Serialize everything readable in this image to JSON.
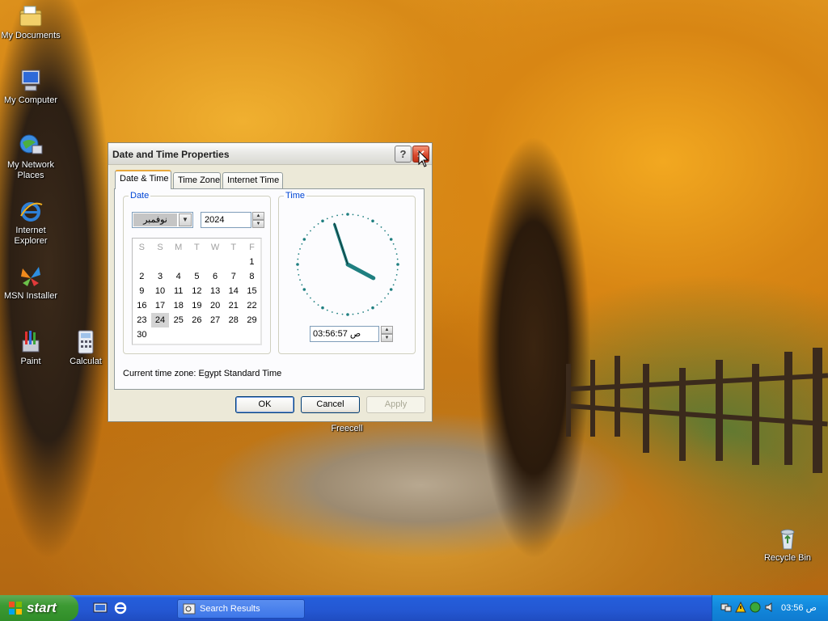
{
  "desktop": {
    "icons": [
      {
        "label": "My Documents",
        "icon": "folder-documents-icon"
      },
      {
        "label": "My Computer",
        "icon": "computer-icon"
      },
      {
        "label": "My Network Places",
        "icon": "network-places-icon"
      },
      {
        "label": "Internet Explorer",
        "icon": "internet-explorer-icon"
      },
      {
        "label": "MSN Installer",
        "icon": "msn-butterfly-icon"
      },
      {
        "label": "Paint",
        "icon": "paint-icon"
      },
      {
        "label": "Calculat",
        "icon": "calculator-icon"
      },
      {
        "label": "Freecell",
        "icon": "freecell-icon"
      },
      {
        "label": "Recycle Bin",
        "icon": "recycle-bin-icon"
      }
    ]
  },
  "dialog": {
    "title": "Date and Time Properties",
    "help_glyph": "?",
    "close_glyph": "✕",
    "tabs": [
      {
        "label": "Date & Time",
        "active": true
      },
      {
        "label": "Time Zone",
        "active": false
      },
      {
        "label": "Internet Time",
        "active": false
      }
    ],
    "date": {
      "group_title": "Date",
      "month": "نوفمبر",
      "year": "2024",
      "weekday_headers": [
        "S",
        "S",
        "M",
        "T",
        "W",
        "T",
        "F"
      ],
      "weeks": [
        [
          "",
          "",
          "",
          "",
          "",
          "",
          "1"
        ],
        [
          "2",
          "3",
          "4",
          "5",
          "6",
          "7",
          "8"
        ],
        [
          "9",
          "10",
          "11",
          "12",
          "13",
          "14",
          "15"
        ],
        [
          "16",
          "17",
          "18",
          "19",
          "20",
          "21",
          "22"
        ],
        [
          "23",
          "24",
          "25",
          "26",
          "27",
          "28",
          "29"
        ],
        [
          "30",
          "",
          "",
          "",
          "",
          "",
          ""
        ]
      ],
      "selected_day": "24"
    },
    "time": {
      "group_title": "Time",
      "value": "03:56:57 ص",
      "hour": 3,
      "minute": 56,
      "second": 57
    },
    "current_time_zone": "Current time zone:  Egypt Standard Time",
    "buttons": {
      "ok": "OK",
      "cancel": "Cancel",
      "apply": "Apply"
    }
  },
  "taskbar": {
    "start_label": "start",
    "tasks": [
      {
        "label": "Search Results",
        "icon": "search-results-icon"
      }
    ],
    "quick_launch": [
      "show-desktop-icon",
      "internet-explorer-icon"
    ],
    "tray_icons": [
      "tray-network-icon",
      "tray-security-alert-icon",
      "tray-update-icon",
      "tray-volume-icon"
    ],
    "clock": "ص 03:56"
  },
  "colors": {
    "taskbar_blue": "#245edb",
    "start_green": "#3c9a33",
    "dialog_face": "#ece9d8",
    "clock_hands": "#1f7f80",
    "clock_dots": "#1f7f80",
    "group_title_blue": "#0046d5"
  }
}
